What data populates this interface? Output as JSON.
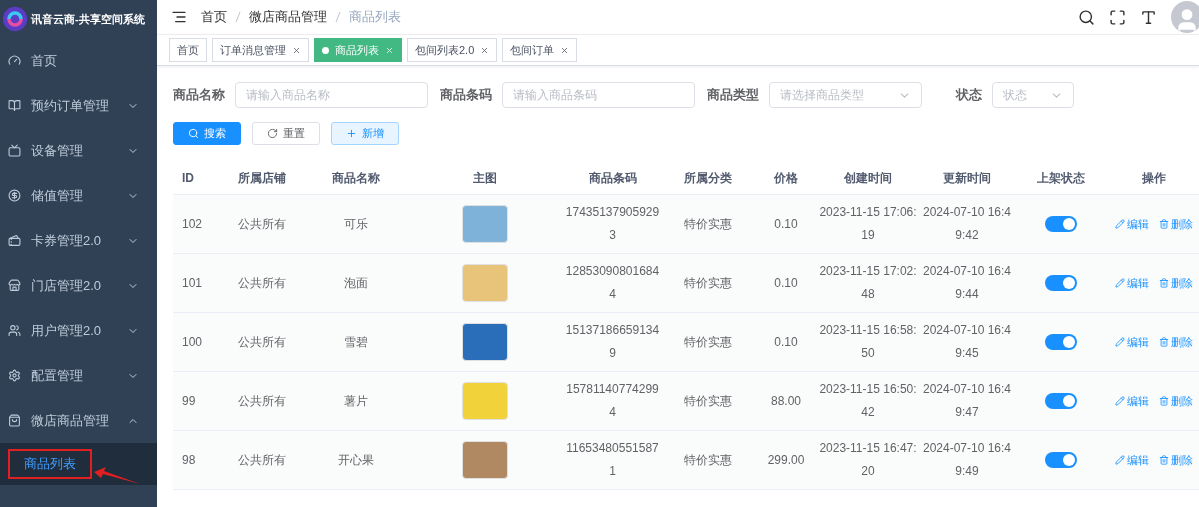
{
  "app": {
    "title": "讯音云商-共享空间系统"
  },
  "sidebar": {
    "items": [
      {
        "kind": "link",
        "label": "首页"
      },
      {
        "kind": "group",
        "label": "预约订单管理",
        "expanded": false
      },
      {
        "kind": "group",
        "label": "设备管理",
        "expanded": false
      },
      {
        "kind": "group",
        "label": "储值管理",
        "expanded": false
      },
      {
        "kind": "group",
        "label": "卡券管理2.0",
        "expanded": false
      },
      {
        "kind": "group",
        "label": "门店管理2.0",
        "expanded": false
      },
      {
        "kind": "group",
        "label": "用户管理2.0",
        "expanded": false
      },
      {
        "kind": "group",
        "label": "配置管理",
        "expanded": false
      },
      {
        "kind": "group",
        "label": "微店商品管理",
        "expanded": true,
        "children": [
          {
            "label": "商品列表",
            "selected": true,
            "highlighted": true
          }
        ]
      }
    ]
  },
  "breadcrumb": [
    "首页",
    "微店商品管理",
    "商品列表"
  ],
  "tabs": [
    {
      "label": "首页",
      "selected": false,
      "closable": false
    },
    {
      "label": "订单消息管理",
      "selected": false,
      "closable": true
    },
    {
      "label": "商品列表",
      "selected": true,
      "closable": true
    },
    {
      "label": "包间列表2.0",
      "selected": false,
      "closable": true
    },
    {
      "label": "包间订单",
      "selected": false,
      "closable": true
    }
  ],
  "filters": [
    {
      "kind": "input",
      "label": "商品名称",
      "placeholder": "请输入商品名称"
    },
    {
      "kind": "input",
      "label": "商品条码",
      "placeholder": "请输入商品条码"
    },
    {
      "kind": "select",
      "label": "商品类型",
      "placeholder": "请选择商品类型"
    },
    {
      "kind": "select",
      "label": "状态",
      "placeholder": "状态"
    }
  ],
  "buttons": [
    {
      "kind": "search",
      "label": "搜索"
    },
    {
      "kind": "reset",
      "label": "重置"
    },
    {
      "kind": "add",
      "label": "新增"
    }
  ],
  "table": {
    "columns": [
      "ID",
      "所属店铺",
      "商品名称",
      "主图",
      "商品条码",
      "所属分类",
      "价格",
      "创建时间",
      "更新时间",
      "上架状态",
      "操作"
    ],
    "rows": [
      {
        "id": "102",
        "shop": "公共所有",
        "name": "可乐",
        "barcode": "174351379059293",
        "category": "特价实惠",
        "price": "0.10",
        "created": "2023-11-15 17:06:19",
        "updated": "2024-07-10 16:49:42",
        "on": true,
        "actions": [
          "编辑",
          "删除"
        ]
      },
      {
        "id": "101",
        "shop": "公共所有",
        "name": "泡面",
        "barcode": "128530908016844",
        "category": "特价实惠",
        "price": "0.10",
        "created": "2023-11-15 17:02:48",
        "updated": "2024-07-10 16:49:44",
        "on": true,
        "actions": [
          "编辑",
          "删除"
        ]
      },
      {
        "id": "100",
        "shop": "公共所有",
        "name": "雪碧",
        "barcode": "151371866591349",
        "category": "特价实惠",
        "price": "0.10",
        "created": "2023-11-15 16:58:50",
        "updated": "2024-07-10 16:49:45",
        "on": true,
        "actions": [
          "编辑",
          "删除"
        ]
      },
      {
        "id": "99",
        "shop": "公共所有",
        "name": "薯片",
        "barcode": "157811407742994",
        "category": "特价实惠",
        "price": "88.00",
        "created": "2023-11-15 16:50:42",
        "updated": "2024-07-10 16:49:47",
        "on": true,
        "actions": [
          "编辑",
          "删除"
        ]
      },
      {
        "id": "98",
        "shop": "公共所有",
        "name": "开心果",
        "barcode": "116534805515871",
        "category": "特价实惠",
        "price": "299.00",
        "created": "2023-11-15 16:47:20",
        "updated": "2024-07-10 16:49:49",
        "on": true,
        "actions": [
          "编辑",
          "删除"
        ]
      }
    ]
  }
}
